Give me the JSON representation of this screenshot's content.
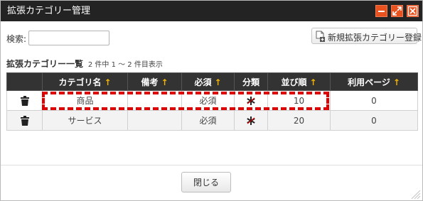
{
  "dialog": {
    "title": "拡張カテゴリー管理"
  },
  "titlebar_buttons": {
    "minimize_icon": "minimize-icon",
    "maximize_icon": "maximize-icon",
    "close_icon": "close-icon"
  },
  "search": {
    "label": "検索:",
    "value": "",
    "placeholder": ""
  },
  "new_button": {
    "label": "新規拡張カテゴリー登録",
    "icon": "new-document-icon"
  },
  "list": {
    "title": "拡張カテゴリー一覧",
    "count_text": "2 件中 1 ～ 2 件目表示"
  },
  "table": {
    "columns": [
      {
        "label": "",
        "sortable": false
      },
      {
        "label": "カテゴリ名",
        "sortable": true
      },
      {
        "label": "備考",
        "sortable": true
      },
      {
        "label": "必須",
        "sortable": true
      },
      {
        "label": "分類",
        "sortable": false
      },
      {
        "label": "並び順",
        "sortable": true
      },
      {
        "label": "利用ページ",
        "sortable": true
      }
    ],
    "sort_arrow": "↑",
    "rows": [
      {
        "name": "商品",
        "note": "",
        "required": "必須",
        "category_icon": "asterisk-icon",
        "order": "10",
        "usage": "0"
      },
      {
        "name": "サービス",
        "note": "",
        "required": "必須",
        "category_icon": "asterisk-icon",
        "order": "20",
        "usage": "0"
      }
    ]
  },
  "footer": {
    "close_label": "閉じる"
  },
  "colors": {
    "titlebar": "#232323",
    "accent": "#e8521f",
    "header": "#333333",
    "sort_arrow": "#f5b400",
    "highlight": "#e00000"
  }
}
